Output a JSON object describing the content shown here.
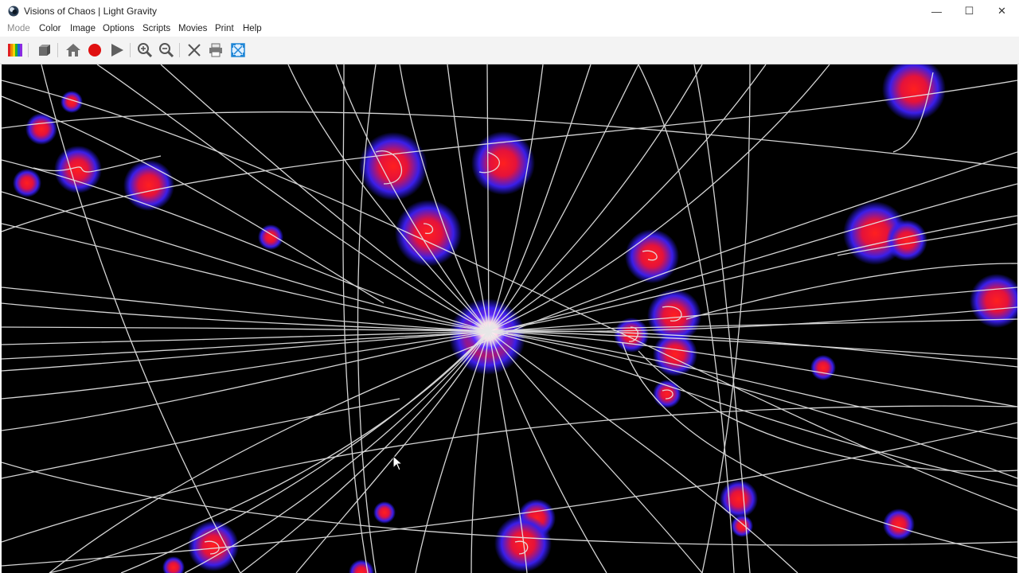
{
  "window": {
    "title": "Visions of Chaos | Light Gravity",
    "minimize": "—",
    "maximize": "☐",
    "close": "✕"
  },
  "menu": [
    {
      "label": "Mode",
      "disabled": true
    },
    {
      "label": "Color"
    },
    {
      "label": "Image"
    },
    {
      "label": "Options"
    },
    {
      "label": "Scripts"
    },
    {
      "label": "Movies"
    },
    {
      "label": "Print"
    },
    {
      "label": "Help"
    }
  ],
  "toolbar": {
    "buttons": [
      "palette-icon",
      "3d-box-icon",
      "home-icon",
      "record-icon",
      "play-icon",
      "zoom-in-icon",
      "zoom-out-icon",
      "tools-icon",
      "print-icon",
      "fullscreen-icon"
    ]
  },
  "colors": {
    "canvas_bg": "#000000",
    "light_path": "#e6e6e6",
    "mass_core": "#ff1a1a",
    "mass_halo": "#2a1cff"
  }
}
